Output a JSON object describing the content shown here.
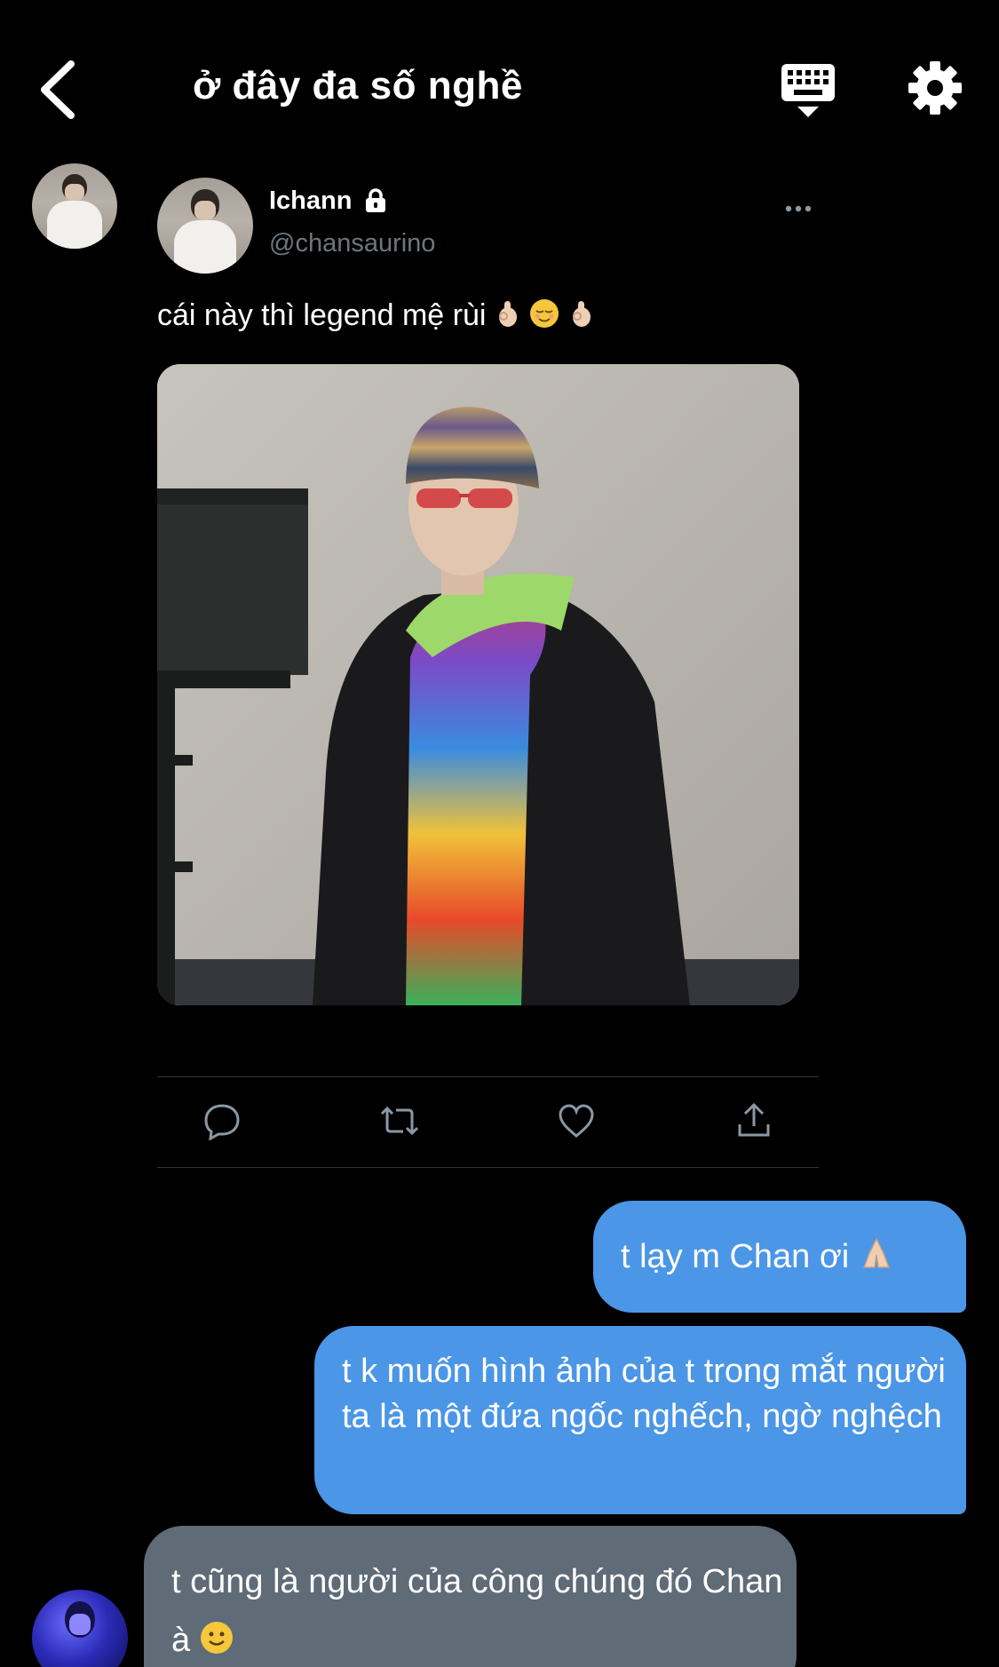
{
  "header": {
    "title": "ở đây đa số nghề",
    "back_icon": "chevron-left-icon",
    "keyboard_icon": "keyboard-icon",
    "settings_icon": "gear-icon"
  },
  "tweet": {
    "author_name": "Ichann",
    "handle": "@chansaurino",
    "text": "cái này thì legend mệ rùi",
    "actions": [
      "reply-icon",
      "retweet-icon",
      "like-icon",
      "share-icon"
    ]
  },
  "messages": [
    {
      "direction": "outgoing",
      "text": "t lạy m Chan ơi"
    },
    {
      "direction": "outgoing",
      "text": "t k muốn hình ảnh của t trong mắt người ta là một đứa ngốc nghếch, ngờ nghệch"
    },
    {
      "direction": "incoming",
      "text": "t cũng là người của công chúng đó Chan à"
    }
  ],
  "colors": {
    "background": "#000000",
    "outgoing_bubble": "#4b96e6",
    "incoming_bubble": "#5f6b76",
    "muted_text": "#6e767d",
    "divider": "#2f3336"
  }
}
